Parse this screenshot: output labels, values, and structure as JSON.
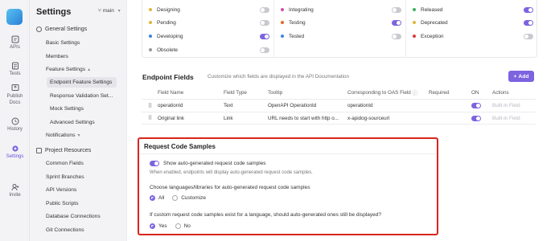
{
  "rail": {
    "items": [
      {
        "label": "APIs",
        "icon": "api-icon"
      },
      {
        "label": "Tests",
        "icon": "tests-icon"
      },
      {
        "label": "Publish Docs",
        "icon": "publish-icon"
      },
      {
        "label": "History",
        "icon": "history-icon"
      },
      {
        "label": "Settings",
        "icon": "gear-icon"
      },
      {
        "label": "Invite",
        "icon": "invite-icon"
      }
    ]
  },
  "nav": {
    "title": "Settings",
    "branch": "main",
    "general_group": "General Settings",
    "basic": "Basic Settings",
    "members": "Members",
    "feature": "Feature Settings",
    "endpoint_feature": "Endpoint Feature Settings",
    "response_validation": "Response Validation Set...",
    "mock": "Mock Settings",
    "advanced": "Advanced Settings",
    "notifications": "Notifications",
    "project_group": "Project Resources",
    "common_fields": "Common Fields",
    "sprint_branches": "Sprint Branches",
    "api_versions": "API Versions",
    "public_scripts": "Public Scripts",
    "database_connections": "Database Connections",
    "git_connections": "Git Connections"
  },
  "statuses": {
    "col1": [
      {
        "label": "Designing",
        "color": "#e0b63a",
        "on": false
      },
      {
        "label": "Pending",
        "color": "#e0b63a",
        "on": false
      },
      {
        "label": "Developing",
        "color": "#3a86e0",
        "on": true
      },
      {
        "label": "Obsolete",
        "color": "#999999",
        "on": false
      }
    ],
    "col2": [
      {
        "label": "Integrating",
        "color": "#d04fa0",
        "on": false
      },
      {
        "label": "Testing",
        "color": "#e06a2a",
        "on": true
      },
      {
        "label": "Tested",
        "color": "#3a86e0",
        "on": false
      }
    ],
    "col3": [
      {
        "label": "Released",
        "color": "#3bb35a",
        "on": true
      },
      {
        "label": "Deprecated",
        "color": "#e0b63a",
        "on": true
      },
      {
        "label": "Exception",
        "color": "#e03a3a",
        "on": false
      }
    ]
  },
  "endpoint_fields": {
    "title": "Endpoint Fields",
    "subtitle": "Customize which fields are displayed in the API Documentation",
    "add_label": "Add",
    "columns": [
      "Field Name",
      "Field Type",
      "Tooltip",
      "Corresponding to OAS Field",
      "Required",
      "ON",
      "Actions"
    ],
    "rows": [
      {
        "name": "operationId",
        "type": "Text",
        "tooltip": "OpenAPI OperationId",
        "oas": "operationId",
        "required": "",
        "on": true,
        "action": "Built-in Field"
      },
      {
        "name": "Original link",
        "type": "Link",
        "tooltip": "URL needs to start with http o...",
        "oas": "x-apidog-sourceurl",
        "required": "",
        "on": true,
        "action": "Built-in Field"
      }
    ]
  },
  "request_code_samples": {
    "title": "Request Code Samples",
    "show_label": "Show auto-generated request code samples",
    "show_on": true,
    "help": "When enabled, endpoints will display auto-generated request code samples.",
    "languages_label": "Choose languages/libraries for auto-generated request code samples",
    "opt_all": "All",
    "opt_customize": "Customize",
    "selected_language_option": "All",
    "custom_question": "If custom request code samples exist for a language, should auto-generated ones still be displayed?",
    "opt_yes": "Yes",
    "opt_no": "No",
    "selected_display_option": "Yes"
  }
}
